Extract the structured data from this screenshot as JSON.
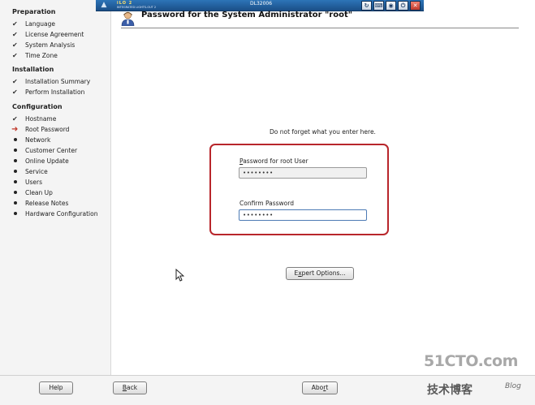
{
  "ilo": {
    "logo_line1": "iLO 2",
    "logo_line2": "INTEGRATED LIGHTS-OUT 2",
    "hostname": "DL32006"
  },
  "sidebar": {
    "sections": [
      {
        "title": "Preparation",
        "steps": [
          {
            "label": "Language",
            "status": "done"
          },
          {
            "label": "License Agreement",
            "status": "done"
          },
          {
            "label": "System Analysis",
            "status": "done"
          },
          {
            "label": "Time Zone",
            "status": "done"
          }
        ]
      },
      {
        "title": "Installation",
        "steps": [
          {
            "label": "Installation Summary",
            "status": "done"
          },
          {
            "label": "Perform Installation",
            "status": "done"
          }
        ]
      },
      {
        "title": "Configuration",
        "steps": [
          {
            "label": "Hostname",
            "status": "done"
          },
          {
            "label": "Root Password",
            "status": "current"
          },
          {
            "label": "Network",
            "status": "pending"
          },
          {
            "label": "Customer Center",
            "status": "pending"
          },
          {
            "label": "Online Update",
            "status": "pending"
          },
          {
            "label": "Service",
            "status": "pending"
          },
          {
            "label": "Users",
            "status": "pending"
          },
          {
            "label": "Clean Up",
            "status": "pending"
          },
          {
            "label": "Release Notes",
            "status": "pending"
          },
          {
            "label": "Hardware Configuration",
            "status": "pending"
          }
        ]
      }
    ]
  },
  "main": {
    "title": "Password for the System Administrator \"root\"",
    "notice": "Do not forget what you enter here.",
    "password_label_key": "P",
    "password_label_rest": "assword for root User",
    "password_value": "••••••••",
    "confirm_label": "Confirm Password",
    "confirm_value": "••••••••",
    "expert_key": "x",
    "expert_pre": "E",
    "expert_rest": "pert Options..."
  },
  "footer": {
    "help": "Help",
    "back_key": "B",
    "back_rest": "ack",
    "abort_pre": "Abo",
    "abort_key": "r",
    "abort_rest": "t"
  },
  "watermark": {
    "main": "51CTO.com",
    "sub": "技术博客",
    "blog": "Blog"
  },
  "colors": {
    "highlight": "#b8262b",
    "ilo_bar": "#1b4f87",
    "current_arrow": "#c0392b"
  }
}
